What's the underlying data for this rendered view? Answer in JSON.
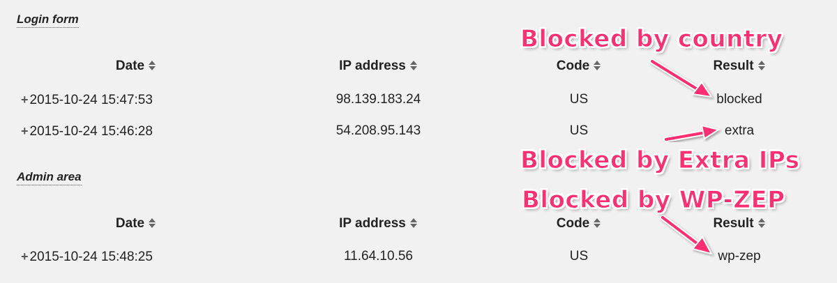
{
  "sections": [
    {
      "title": "Login form",
      "headers": [
        "Date",
        "IP address",
        "Code",
        "Result"
      ],
      "rows": [
        {
          "date": "2015-10-24 15:47:53",
          "ip": "98.139.183.24",
          "code": "US",
          "result": "blocked"
        },
        {
          "date": "2015-10-24 15:46:28",
          "ip": "54.208.95.143",
          "code": "US",
          "result": "extra"
        }
      ]
    },
    {
      "title": "Admin area",
      "headers": [
        "Date",
        "IP address",
        "Code",
        "Result"
      ],
      "rows": [
        {
          "date": "2015-10-24 15:48:25",
          "ip": "11.64.10.56",
          "code": "US",
          "result": "wp-zep"
        }
      ]
    }
  ],
  "annotations": {
    "country": "Blocked by country",
    "extra": "Blocked by Extra IPs",
    "wpzep": "Blocked by WP-ZEP"
  },
  "icons": {
    "sort": "sort-icon",
    "expand": "plus-icon"
  },
  "colors": {
    "annotation": "#ff2e73",
    "background": "#f1f1f1"
  }
}
